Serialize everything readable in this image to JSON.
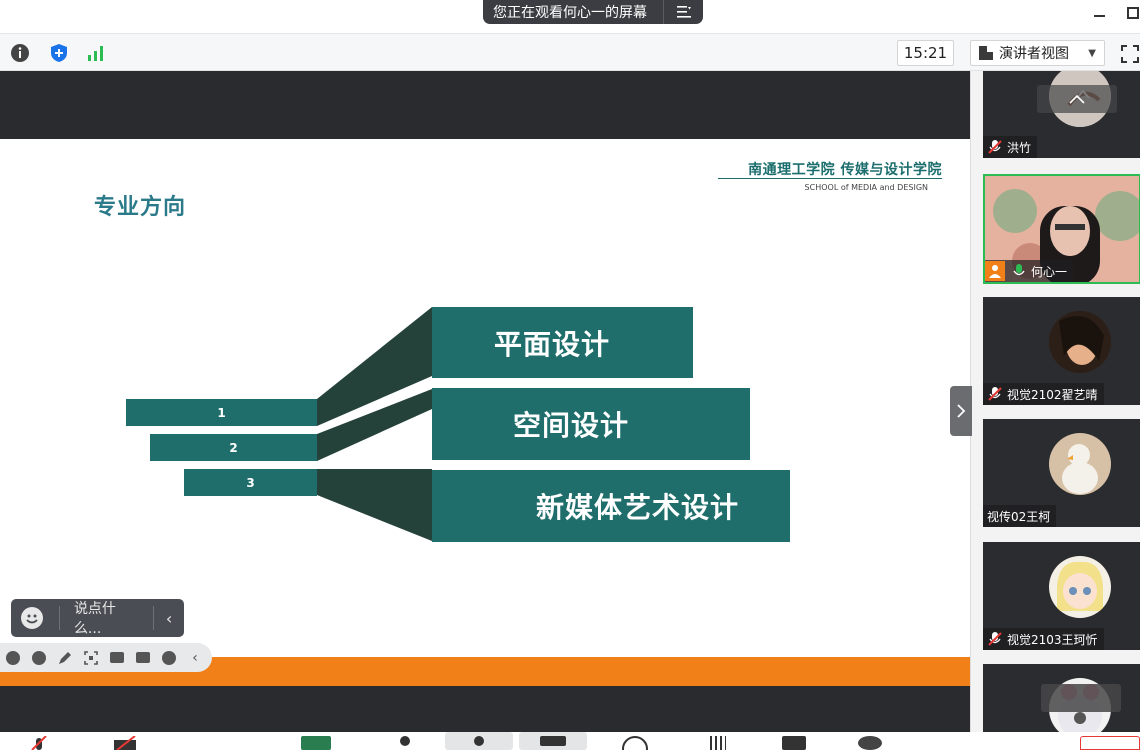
{
  "share_banner": {
    "text": "您正在观看何心一的屏幕",
    "menu_icon": "list-menu-icon"
  },
  "toolbar": {
    "icons": [
      "info-icon",
      "shield-icon",
      "signal-icon"
    ],
    "time": "15:21",
    "view_label": "演讲者视图",
    "accent_blue": "#1a73e8",
    "signal_green": "#2dbb53"
  },
  "slide": {
    "school_cn": "南通理工学院 传媒与设计学院",
    "school_en": "SCHOOL of MEDIA and DESIGN",
    "title": "专业方向",
    "items": [
      {
        "num": "1",
        "label": "平面设计"
      },
      {
        "num": "2",
        "label": "空间设计"
      },
      {
        "num": "3",
        "label": "新媒体艺术设计"
      }
    ],
    "teal": "#1f6e6c",
    "dark_teal": "#24423a"
  },
  "chat": {
    "placeholder": "说点什么..."
  },
  "participants": [
    {
      "name": "洪竹",
      "muted": true
    },
    {
      "name": "何心一",
      "muted": false,
      "active": true
    },
    {
      "name": "视觉2102翟艺晴",
      "muted": true
    },
    {
      "name": "视传02王柯",
      "muted": false
    },
    {
      "name": "视觉2103王珂忻",
      "muted": true
    },
    {
      "name": "",
      "muted": false
    }
  ],
  "colors": {
    "orange_bar": "#f18019",
    "dark_stage": "#2a2b2e"
  }
}
